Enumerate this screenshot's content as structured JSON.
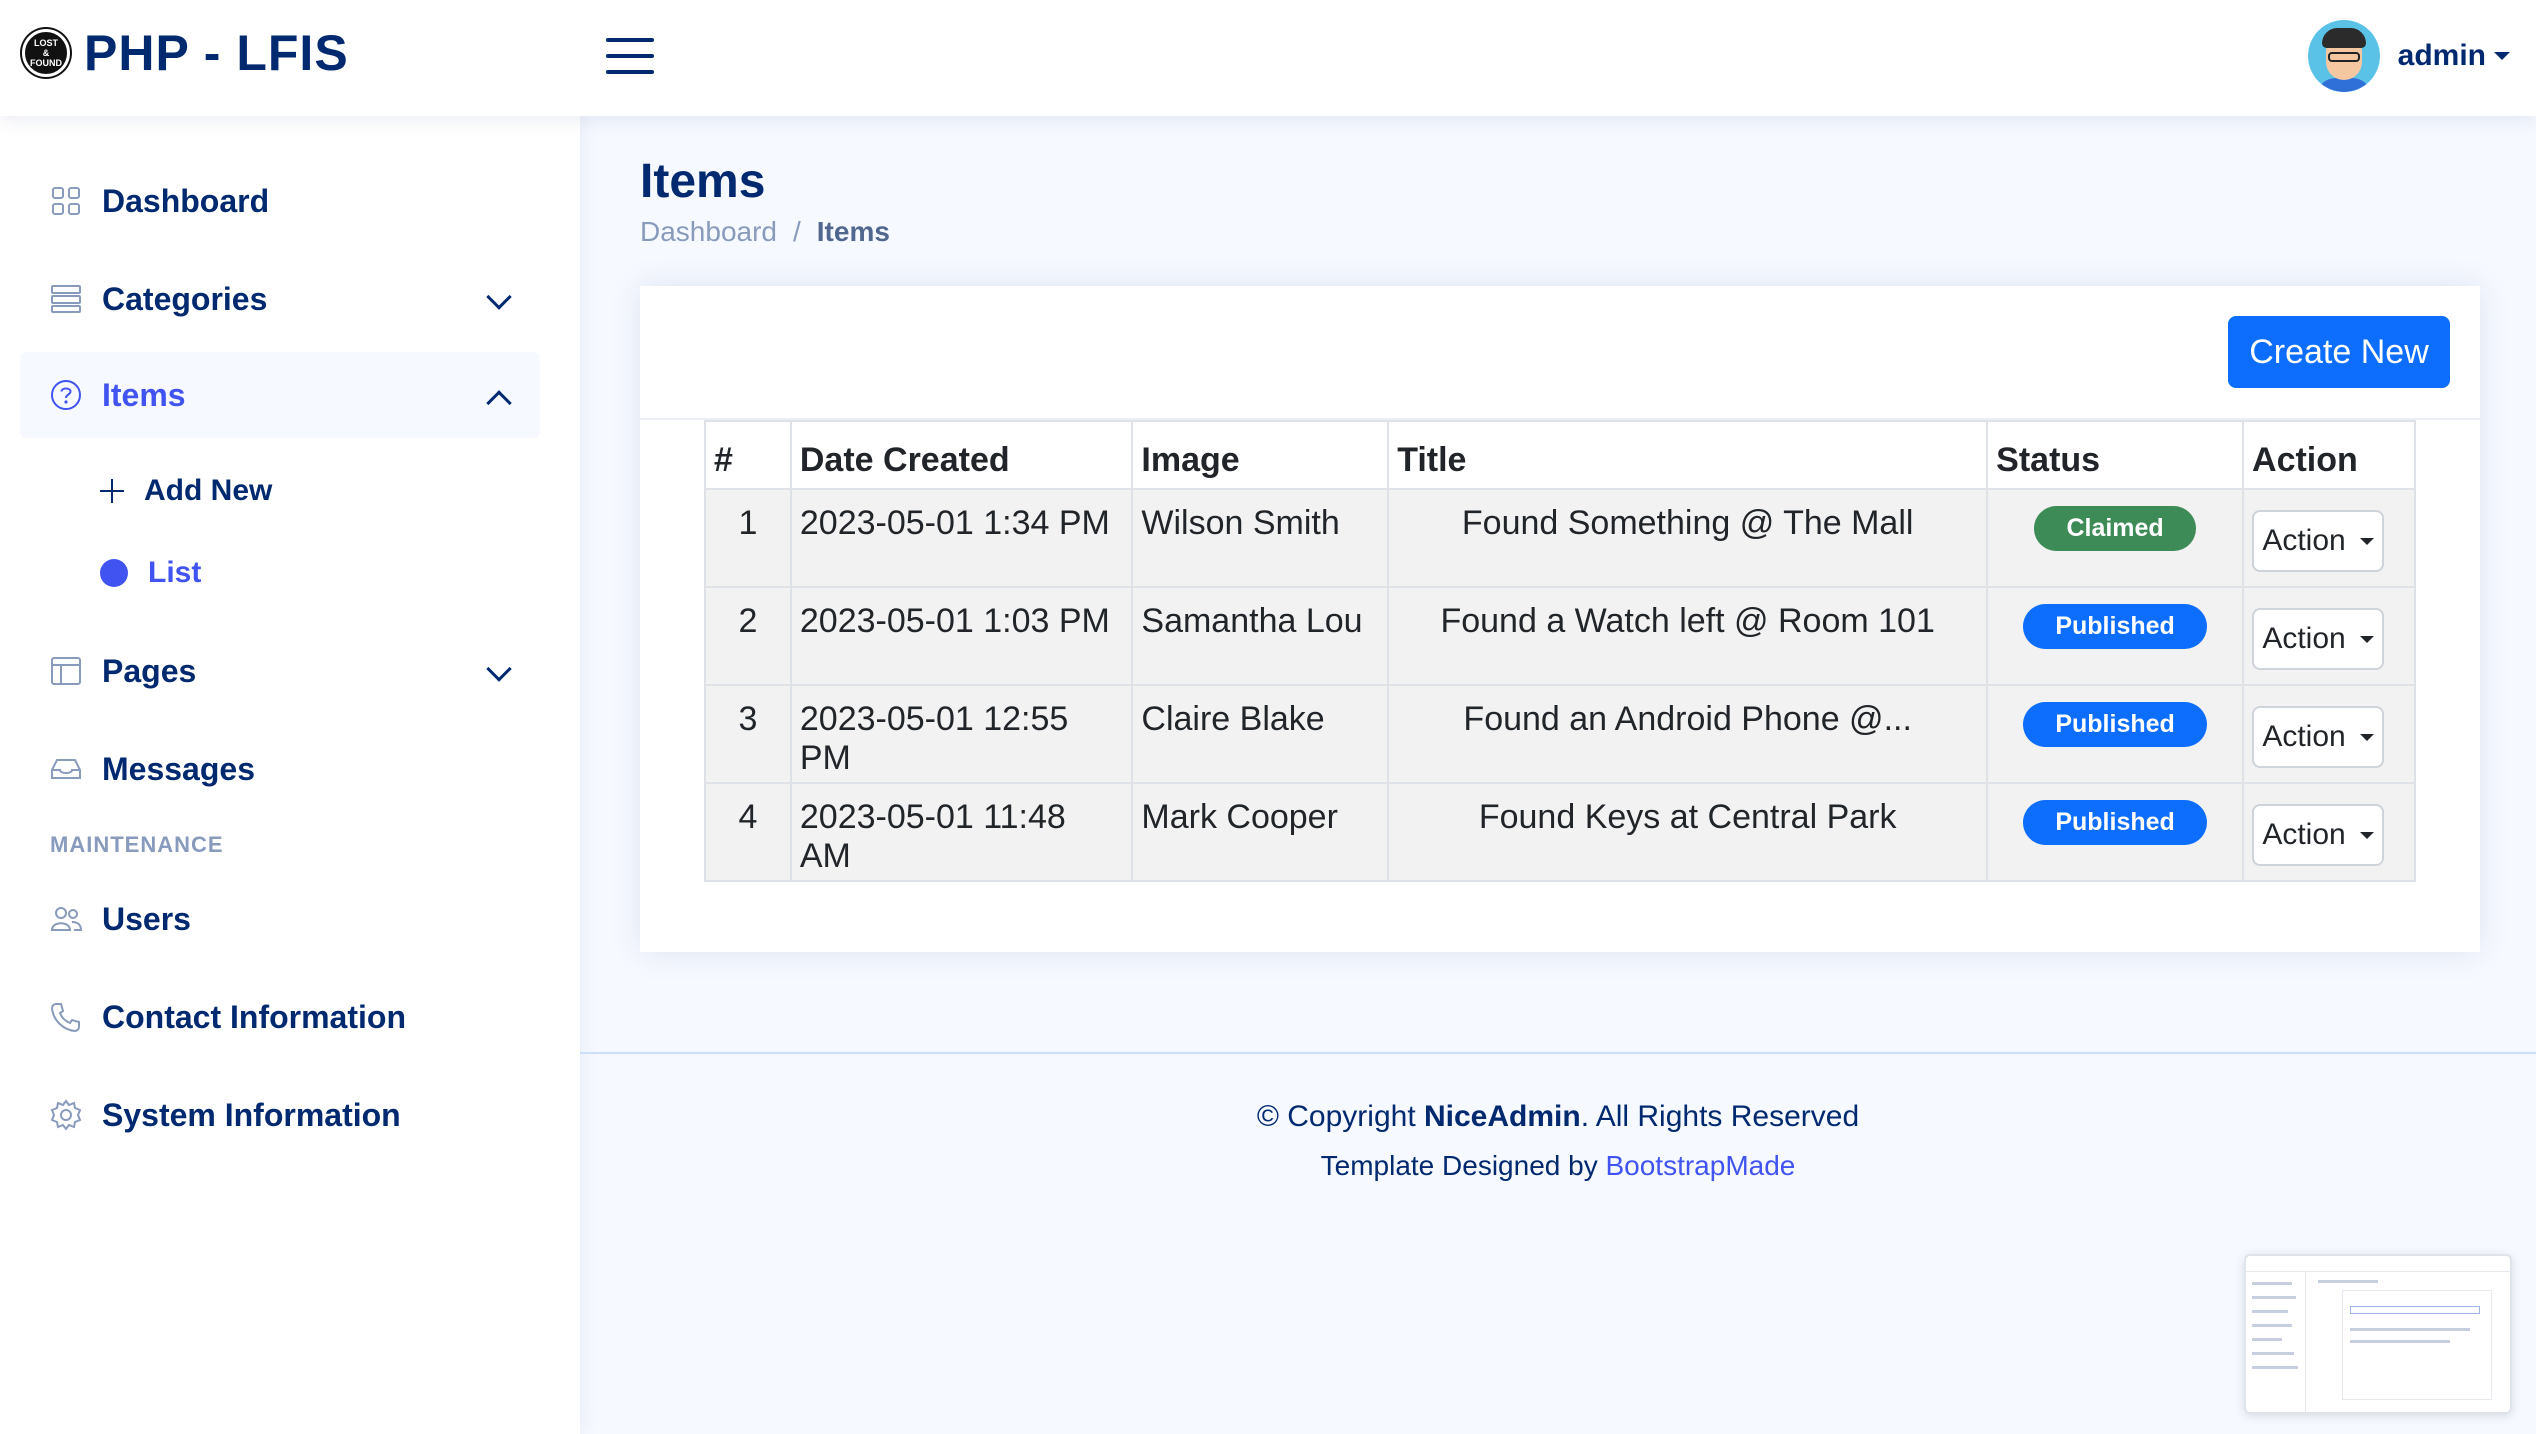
{
  "app": {
    "logo_badge": [
      "LOST",
      "&",
      "FOUND"
    ],
    "title": "PHP - LFIS"
  },
  "header": {
    "user_name": "admin"
  },
  "sidebar": {
    "items": [
      {
        "label": "Dashboard",
        "icon": "grid-icon"
      },
      {
        "label": "Categories",
        "icon": "list-stack-icon"
      },
      {
        "label": "Items",
        "icon": "question-circle-icon"
      },
      {
        "label": "Pages",
        "icon": "layout-icon"
      },
      {
        "label": "Messages",
        "icon": "inbox-icon"
      }
    ],
    "sub_items": [
      {
        "label": "Add New"
      },
      {
        "label": "List"
      }
    ],
    "heading": "MAINTENANCE",
    "maintenance_items": [
      {
        "label": "Users",
        "icon": "people-icon"
      },
      {
        "label": "Contact Information",
        "icon": "telephone-icon"
      },
      {
        "label": "System Information",
        "icon": "gear-icon"
      }
    ]
  },
  "main": {
    "title": "Items",
    "breadcrumb": {
      "root": "Dashboard",
      "separator": "/",
      "current": "Items"
    },
    "create_button": "Create New",
    "table": {
      "headers": [
        "#",
        "Date Created",
        "Image",
        "Title",
        "Status",
        "Action"
      ],
      "rows": [
        {
          "num": "1",
          "date": "2023-05-01 1:34 PM",
          "image": "Wilson Smith",
          "title": "Found Something @ The Mall",
          "status": "Claimed",
          "action": "Action"
        },
        {
          "num": "2",
          "date": "2023-05-01 1:03 PM",
          "image": "Samantha Lou",
          "title": "Found a Watch left @ Room 101",
          "status": "Published",
          "action": "Action"
        },
        {
          "num": "3",
          "date": "2023-05-01 12:55 PM",
          "image": "Claire Blake",
          "title": "Found an Android Phone @...",
          "status": "Published",
          "action": "Action"
        },
        {
          "num": "4",
          "date": "2023-05-01 11:48 AM",
          "image": "Mark Cooper",
          "title": "Found Keys at Central Park",
          "status": "Published",
          "action": "Action"
        }
      ]
    }
  },
  "footer": {
    "copyright_prefix": "© Copyright ",
    "brand": "NiceAdmin",
    "copyright_suffix": ". All Rights Reserved",
    "designed_by": "Template Designed by ",
    "designer_link": "BootstrapMade"
  },
  "colors": {
    "primary": "#4154f1",
    "navy": "#012970",
    "button_blue": "#0d6efd",
    "claimed_green": "#3d8b57",
    "background": "#f6f9ff"
  }
}
